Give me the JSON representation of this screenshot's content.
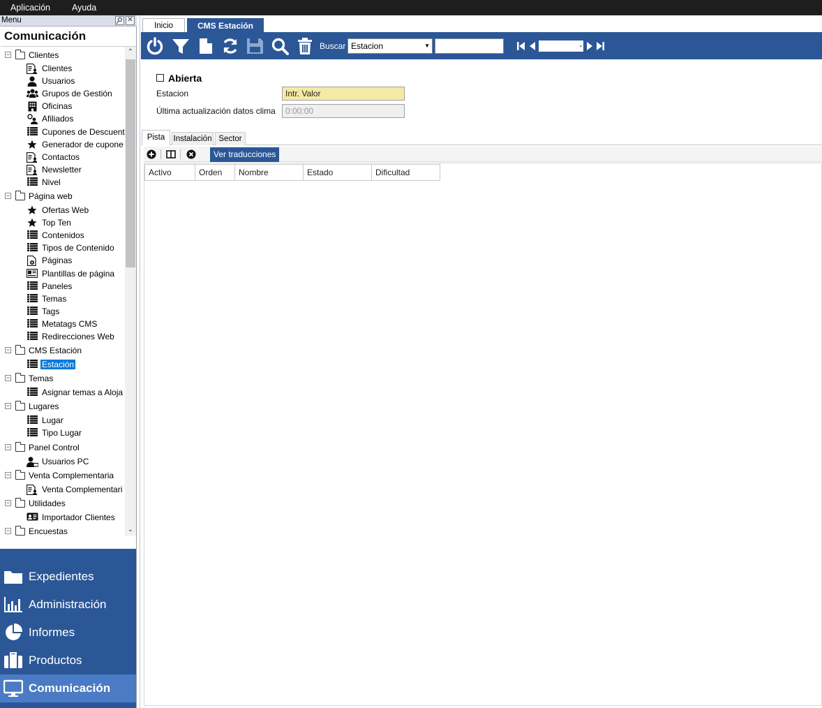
{
  "menubar": {
    "items": [
      "Aplicación",
      "Ayuda"
    ]
  },
  "sidebar": {
    "header_label": "Menu",
    "title": "Comunicación",
    "groups": [
      {
        "label": "Clientes",
        "items": [
          {
            "label": "Clientes",
            "icon": "contact-card-icon"
          },
          {
            "label": "Usuarios",
            "icon": "user-icon"
          },
          {
            "label": "Grupos de Gestión",
            "icon": "users-group-icon"
          },
          {
            "label": "Oficinas",
            "icon": "building-icon"
          },
          {
            "label": "Afiliados",
            "icon": "affiliate-icon"
          },
          {
            "label": "Cupones de Descuent",
            "icon": "list-icon"
          },
          {
            "label": "Generador de cupone",
            "icon": "star-icon"
          },
          {
            "label": "Contactos",
            "icon": "contact-card-icon"
          },
          {
            "label": "Newsletter",
            "icon": "contact-card-icon"
          },
          {
            "label": "Nivel",
            "icon": "list-icon"
          }
        ]
      },
      {
        "label": "Página web",
        "items": [
          {
            "label": "Ofertas Web",
            "icon": "star-icon"
          },
          {
            "label": "Top Ten",
            "icon": "star-icon"
          },
          {
            "label": "Contenidos",
            "icon": "list-icon"
          },
          {
            "label": "Tipos de Contenido",
            "icon": "list-icon"
          },
          {
            "label": "Páginas",
            "icon": "page-icon"
          },
          {
            "label": "Plantillas de página",
            "icon": "template-icon"
          },
          {
            "label": "Paneles",
            "icon": "list-icon"
          },
          {
            "label": "Temas",
            "icon": "list-icon"
          },
          {
            "label": "Tags",
            "icon": "list-icon"
          },
          {
            "label": "Metatags CMS",
            "icon": "list-icon"
          },
          {
            "label": "Redirecciones Web",
            "icon": "list-icon"
          }
        ]
      },
      {
        "label": "CMS Estación",
        "items": [
          {
            "label": "Estación",
            "icon": "list-icon",
            "selected": true
          }
        ]
      },
      {
        "label": "Temas",
        "items": [
          {
            "label": "Asignar temas a Aloja",
            "icon": "list-icon"
          }
        ]
      },
      {
        "label": "Lugares",
        "items": [
          {
            "label": "Lugar",
            "icon": "list-icon"
          },
          {
            "label": "Tipo Lugar",
            "icon": "list-icon"
          }
        ]
      },
      {
        "label": "Panel Control",
        "items": [
          {
            "label": "Usuarios PC",
            "icon": "user-pc-icon"
          }
        ]
      },
      {
        "label": "Venta Complementaria",
        "items": [
          {
            "label": "Venta Complementari",
            "icon": "contact-card-icon"
          }
        ]
      },
      {
        "label": "Utilidades",
        "items": [
          {
            "label": "Importador Clientes",
            "icon": "id-card-icon"
          }
        ]
      },
      {
        "label": "Encuestas",
        "items": []
      }
    ]
  },
  "modules": [
    {
      "label": "Expedientes",
      "icon": "folder-icon"
    },
    {
      "label": "Administración",
      "icon": "bar-chart-icon"
    },
    {
      "label": "Informes",
      "icon": "pie-chart-icon"
    },
    {
      "label": "Productos",
      "icon": "briefcase-icon"
    },
    {
      "label": "Comunicación",
      "icon": "monitor-icon",
      "active": true
    }
  ],
  "doc_tabs": [
    {
      "label": "Inicio"
    },
    {
      "label": "CMS Estación",
      "active": true
    }
  ],
  "toolbar": {
    "buttons": [
      "power-icon",
      "filter-icon",
      "new-document-icon",
      "refresh-icon",
      "save-icon",
      "search-icon",
      "delete-icon"
    ],
    "search_label": "Buscar",
    "search_field_value": "Estacion",
    "search_text": "",
    "pager_value": "-"
  },
  "form": {
    "checkbox_label": "Abierta",
    "checkbox_checked": false,
    "estacion_label": "Estacion",
    "estacion_value": "Intr. Valor",
    "clima_label": "Última actualización datos clima",
    "clima_value": "0:00:00"
  },
  "sub_tabs": [
    {
      "label": "Pista",
      "active": true
    },
    {
      "label": "Instalación"
    },
    {
      "label": "Sector"
    }
  ],
  "grid_toolbar": {
    "translate_label": "Ver traducciones"
  },
  "grid": {
    "columns": [
      "Activo",
      "Orden",
      "Nombre",
      "Estado",
      "Dificultad"
    ],
    "rows": []
  },
  "colors": {
    "accent": "#2b5797",
    "accent_active": "#4a7bc4",
    "selection": "#0a78d7",
    "required_field": "#f5eaa4"
  }
}
